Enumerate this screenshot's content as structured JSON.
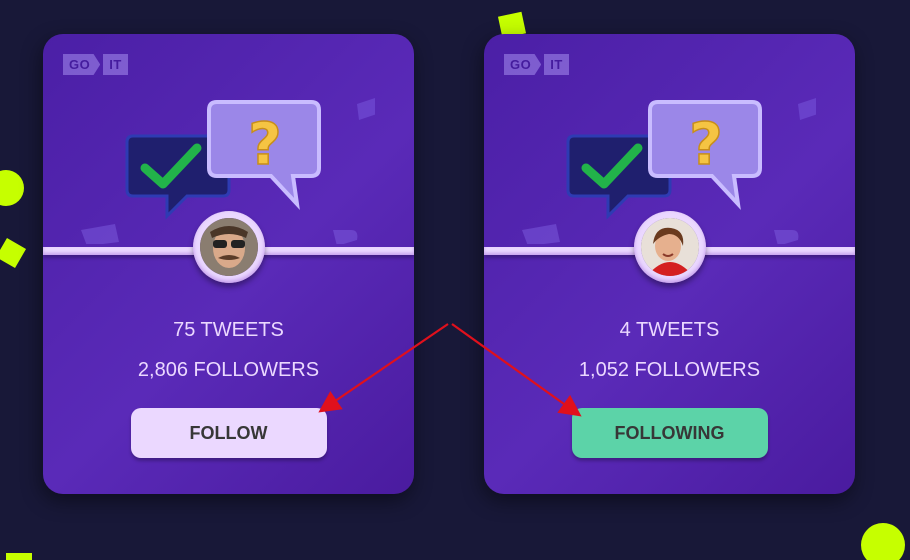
{
  "colors": {
    "background": "#181838",
    "card": "#5a2ab8",
    "accent_lime": "#c6ff00",
    "button_follow": "#ebd8ff",
    "button_following": "#5cd3a8",
    "annotation_arrow": "#e0101c"
  },
  "logo": {
    "part1": "GO",
    "part2": "IT"
  },
  "cards": [
    {
      "avatar_icon": "man-with-sunglasses-avatar",
      "tweets": "75 TWEETS",
      "followers": "2,806 FOLLOWERS",
      "button_label": "FOLLOW"
    },
    {
      "avatar_icon": "woman-avatar",
      "tweets": "4 TWEETS",
      "followers": "1,052 FOLLOWERS",
      "button_label": "FOLLOWING"
    }
  ],
  "illustration_icons": [
    "checkmark-bubble-icon",
    "question-bubble-icon",
    "like-icon",
    "chat-icon"
  ]
}
